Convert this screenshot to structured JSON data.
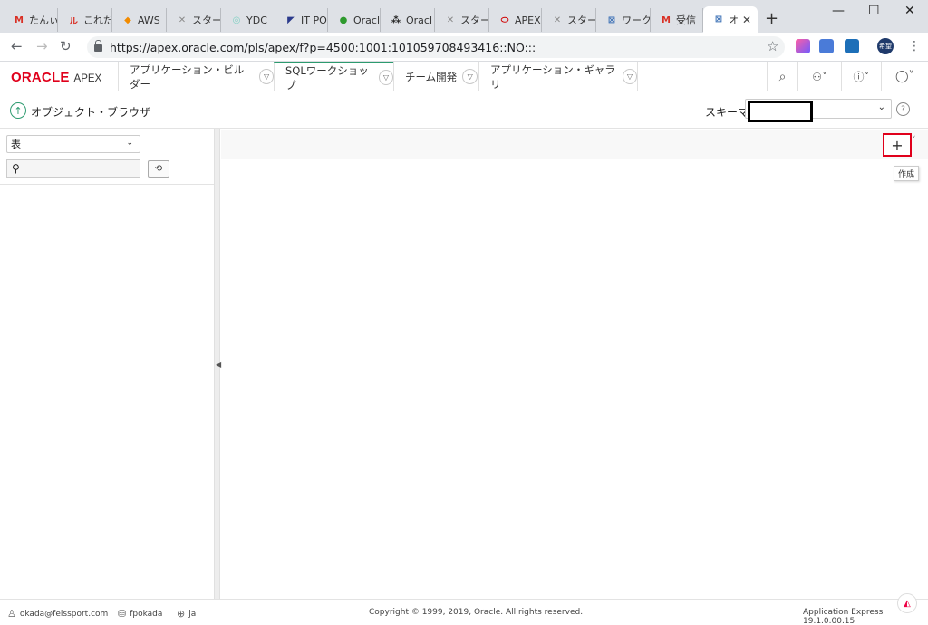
{
  "browser": {
    "tabs": [
      {
        "label": "たんぃ",
        "icon": "gmail-icon",
        "color": "#d93025"
      },
      {
        "label": "これだ",
        "icon": "note-icon",
        "color": "#d93025"
      },
      {
        "label": "AWS",
        "icon": "aws-icon",
        "color": "#f28b00"
      },
      {
        "label": "スター",
        "icon": "tool-icon",
        "color": "#8a8a8a"
      },
      {
        "label": "YDC",
        "icon": "ydc-icon",
        "color": "#7fd1c3"
      },
      {
        "label": "IT PO",
        "icon": "itpro-icon",
        "color": "#2b3a8c"
      },
      {
        "label": "Oracl",
        "icon": "oracle-green-icon",
        "color": "#2e9a2e"
      },
      {
        "label": "Oracl",
        "icon": "grid-icon",
        "color": "#222222"
      },
      {
        "label": "スター",
        "icon": "tool-icon",
        "color": "#8a8a8a"
      },
      {
        "label": "APEX",
        "icon": "oracle-red-icon",
        "color": "#d00000"
      },
      {
        "label": "スター",
        "icon": "tool-icon",
        "color": "#8a8a8a"
      },
      {
        "label": "ワーク",
        "icon": "apex-icon",
        "color": "#3a6fb5"
      },
      {
        "label": "受信",
        "icon": "gmail-icon",
        "color": "#d93025"
      },
      {
        "label": "オ",
        "icon": "apex-icon",
        "color": "#3a6fb5",
        "active": true
      }
    ],
    "url": "https://apex.oracle.com/pls/apex/f?p=4500:1001:101059708493416::NO:::",
    "profile_initials": "希望"
  },
  "apex": {
    "logo_oracle": "ORACLE",
    "logo_apex": "APEX",
    "nav": [
      {
        "label": "アプリケーション・ビルダー"
      },
      {
        "label": "SQLワークショップ",
        "active": true
      },
      {
        "label": "チーム開発"
      },
      {
        "label": "アプリケーション・ギャラリ"
      }
    ]
  },
  "page": {
    "breadcrumb": "オブジェクト・ブラウザ",
    "schema_label": "スキーマ",
    "help": "?"
  },
  "left": {
    "object_type": "表",
    "search_value": ""
  },
  "right": {
    "create_symbol": "+",
    "tooltip": "作成"
  },
  "footer": {
    "user": "okada@feissport.com",
    "workspace": "fpokada",
    "language": "ja",
    "copyright": "Copyright © 1999, 2019, Oracle. All rights reserved.",
    "version": "Application Express 19.1.0.00.15"
  },
  "colors": {
    "oracle_red": "#e0001b",
    "apex_green": "#2d9b6f",
    "highlight_border": "#e0001b"
  }
}
